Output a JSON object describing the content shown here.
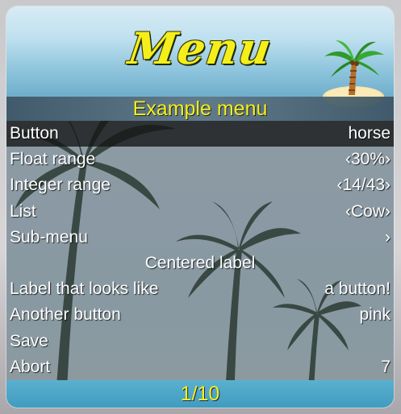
{
  "menu": {
    "title": "Menu",
    "subtitle": "Example menu",
    "items": [
      {
        "label": "Button",
        "value": "horse",
        "selected": true
      },
      {
        "label": "Float range",
        "value": "‹30%›"
      },
      {
        "label": "Integer range",
        "value": "‹14/43›"
      },
      {
        "label": "List",
        "value": "‹Cow›"
      },
      {
        "label": "Sub-menu",
        "value": "›"
      },
      {
        "center_label": "Centered label"
      },
      {
        "label": "Label that looks like",
        "value": "a button!"
      },
      {
        "label": "Another button",
        "value": "pink"
      },
      {
        "label": "Save",
        "value": ""
      },
      {
        "label": "Abort",
        "value": "7"
      }
    ],
    "pagination": "1/10"
  },
  "colors": {
    "accent_yellow": "#f4ef1a",
    "selected_bg": "#141414",
    "footer_bg": "#4aa6c8"
  },
  "icons": {
    "banner_icon": "palm-island-icon"
  }
}
